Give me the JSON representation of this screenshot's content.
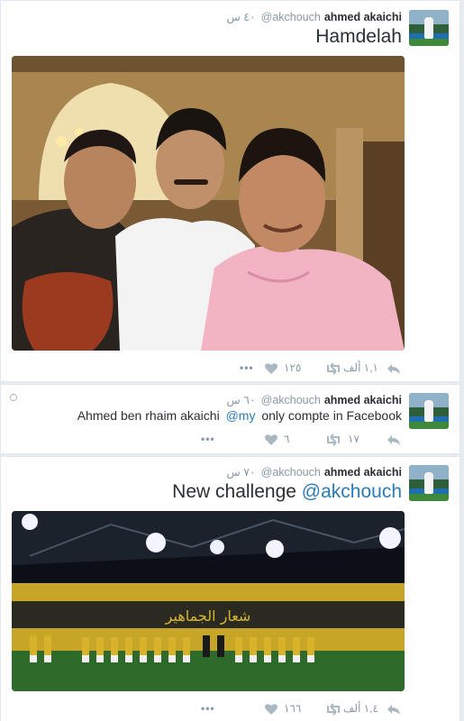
{
  "tweets": [
    {
      "name": "ahmed akaichi",
      "handle": "@akchouch",
      "time": "٤٠ س",
      "text": "Hamdelah",
      "retweets": "١,١ ألف",
      "likes": "١٢٥"
    },
    {
      "name": "ahmed akaichi",
      "handle": "@akchouch",
      "time": "٦٠ س",
      "text_before": "Ahmed ben rhaim akaichi",
      "mention": "@my",
      "text_after": "only compte in Facebook",
      "retweets": "١٧",
      "likes": "٦"
    },
    {
      "name": "ahmed akaichi",
      "handle": "@akchouch",
      "time": "٧٠ س",
      "text": "New challenge",
      "mention": "@akchouch",
      "retweets": "١,٤ ألف",
      "likes": "١٦٦"
    }
  ],
  "icons": {
    "reply": "reply-icon",
    "retweet": "retweet-icon",
    "like": "heart-icon",
    "more": "more-icon"
  },
  "colors": {
    "link": "#2b7bb9",
    "meta": "#8899a6",
    "text": "#292f33",
    "border": "#e1e8ed"
  }
}
